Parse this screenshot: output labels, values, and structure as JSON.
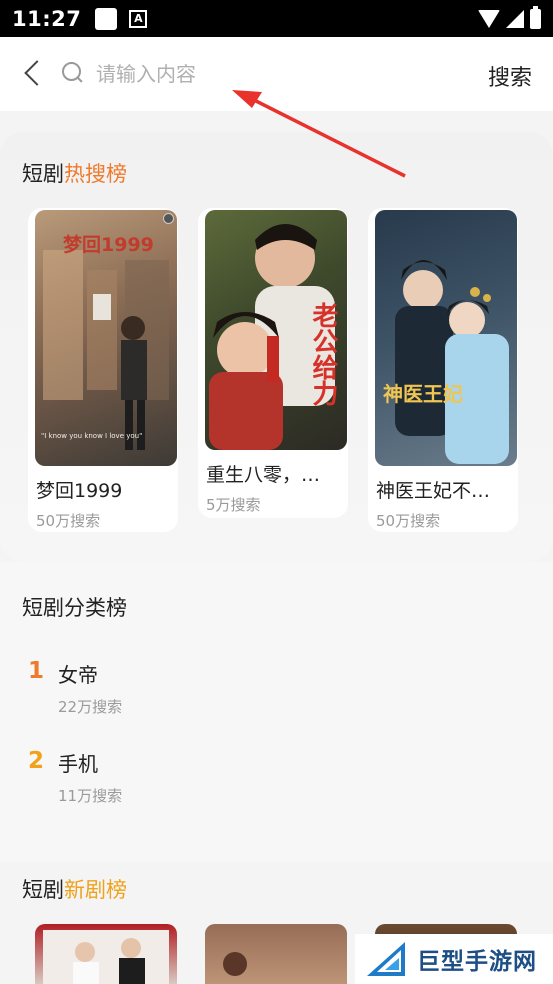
{
  "status_bar": {
    "time": "11:27",
    "a_icon": "A"
  },
  "search": {
    "placeholder": "请输入内容",
    "button_label": "搜索"
  },
  "hot": {
    "title_prefix": "短剧",
    "title_accent": "热搜榜",
    "items": [
      {
        "name": "梦回1999",
        "count": "50万搜索",
        "poster_text": "梦回1999"
      },
      {
        "name": "重生八零，…",
        "count": "5万搜索",
        "poster_text": "老公给力"
      },
      {
        "name": "神医王妃不…",
        "count": "50万搜索",
        "poster_text": "神医王妃"
      }
    ]
  },
  "category": {
    "title": "短剧分类榜",
    "items": [
      {
        "rank": "1",
        "name": "女帝",
        "count": "22万搜索"
      },
      {
        "rank": "2",
        "name": "手机",
        "count": "11万搜索"
      }
    ]
  },
  "new_list": {
    "title_prefix": "短剧",
    "title_accent": "新剧榜"
  },
  "watermark": {
    "text": "巨型手游网"
  },
  "colors": {
    "accent_orange": "#f07a2c",
    "accent_gold": "#f0a21a",
    "arrow_red": "#e8322b"
  }
}
